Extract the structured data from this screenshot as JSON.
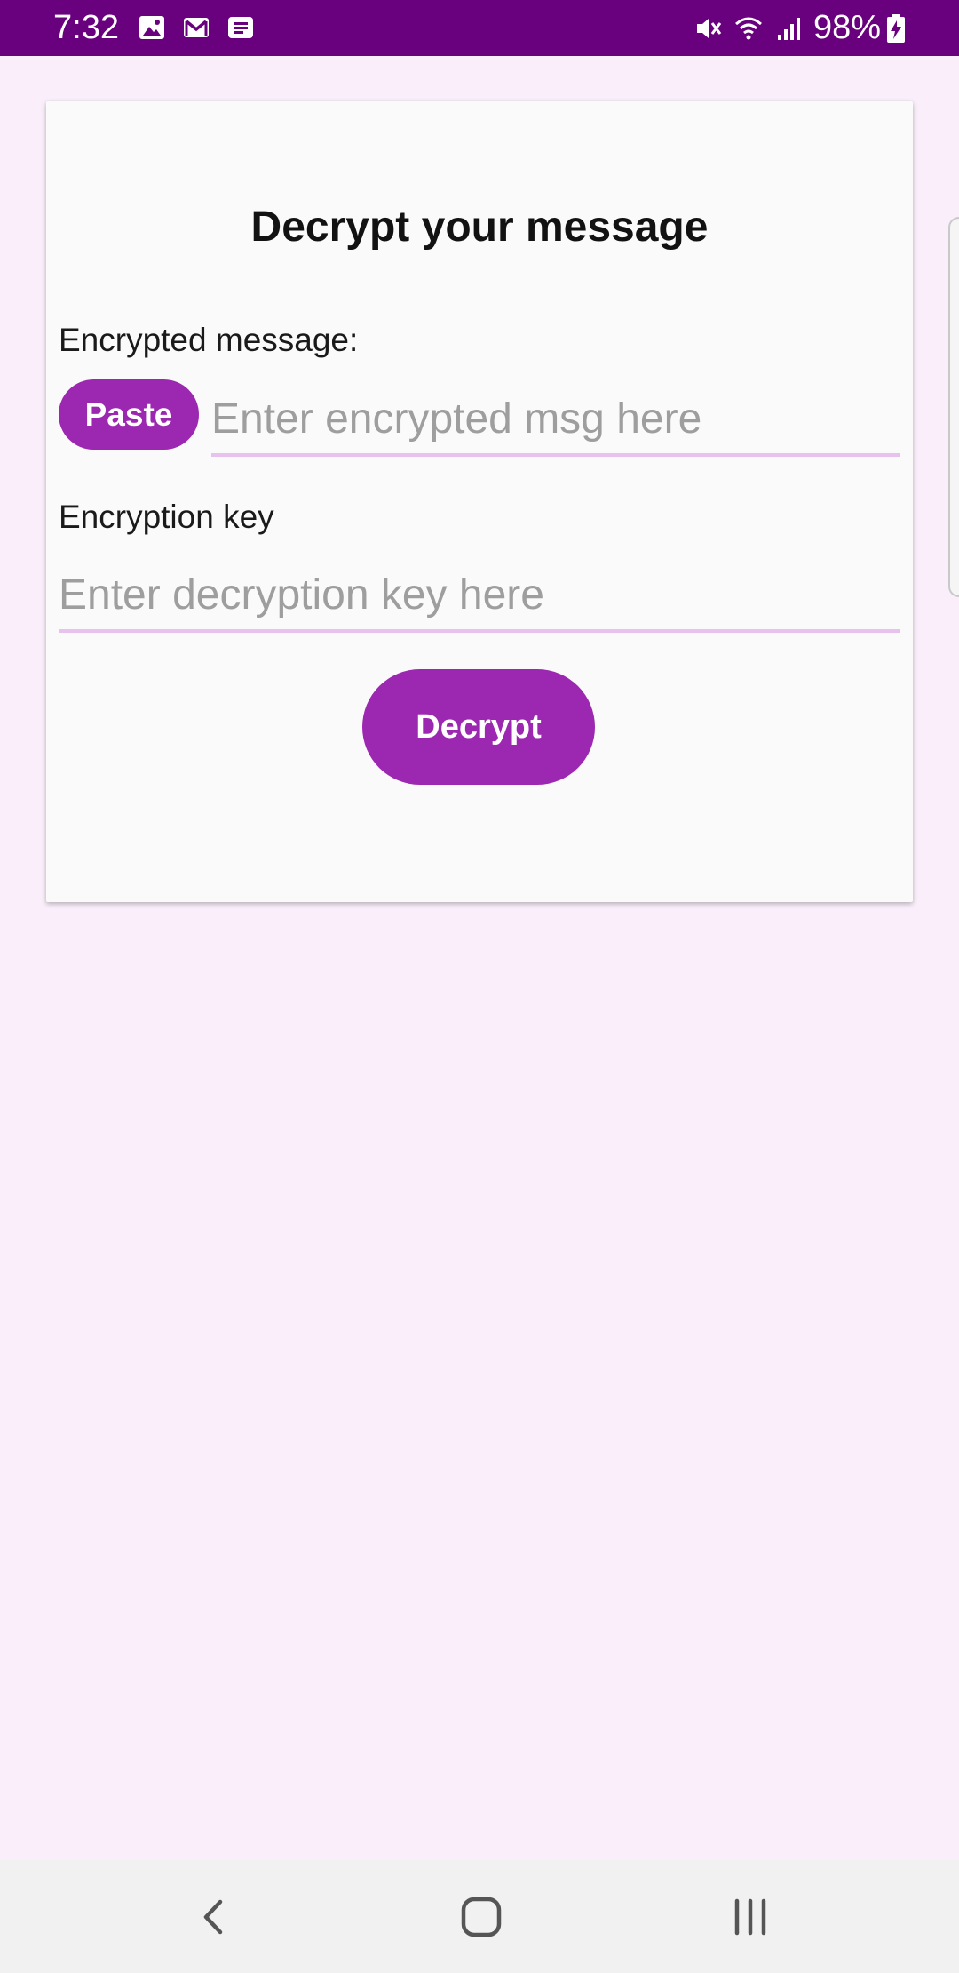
{
  "status_bar": {
    "time": "7:32",
    "notification_icons": [
      "gallery-icon",
      "gmail-icon",
      "message-icon"
    ],
    "system_icons": [
      "mute-icon",
      "wifi-icon",
      "signal-icon",
      "battery-charging-icon"
    ],
    "battery": "98%",
    "background_color": "#69007e"
  },
  "form": {
    "title": "Decrypt your message",
    "encrypted_label": "Encrypted message:",
    "paste_label": "Paste",
    "encrypted_placeholder": "Enter encrypted msg here",
    "key_label": "Encryption key",
    "key_placeholder": "Enter decryption key here",
    "decrypt_label": "Decrypt"
  },
  "colors": {
    "accent": "#9c27b0",
    "page_background": "#f9eefa",
    "card_background": "#fafafa",
    "input_underline": "#e8c2ee"
  },
  "nav_bar": {
    "buttons": [
      "back-icon",
      "home-icon",
      "recents-icon"
    ]
  }
}
